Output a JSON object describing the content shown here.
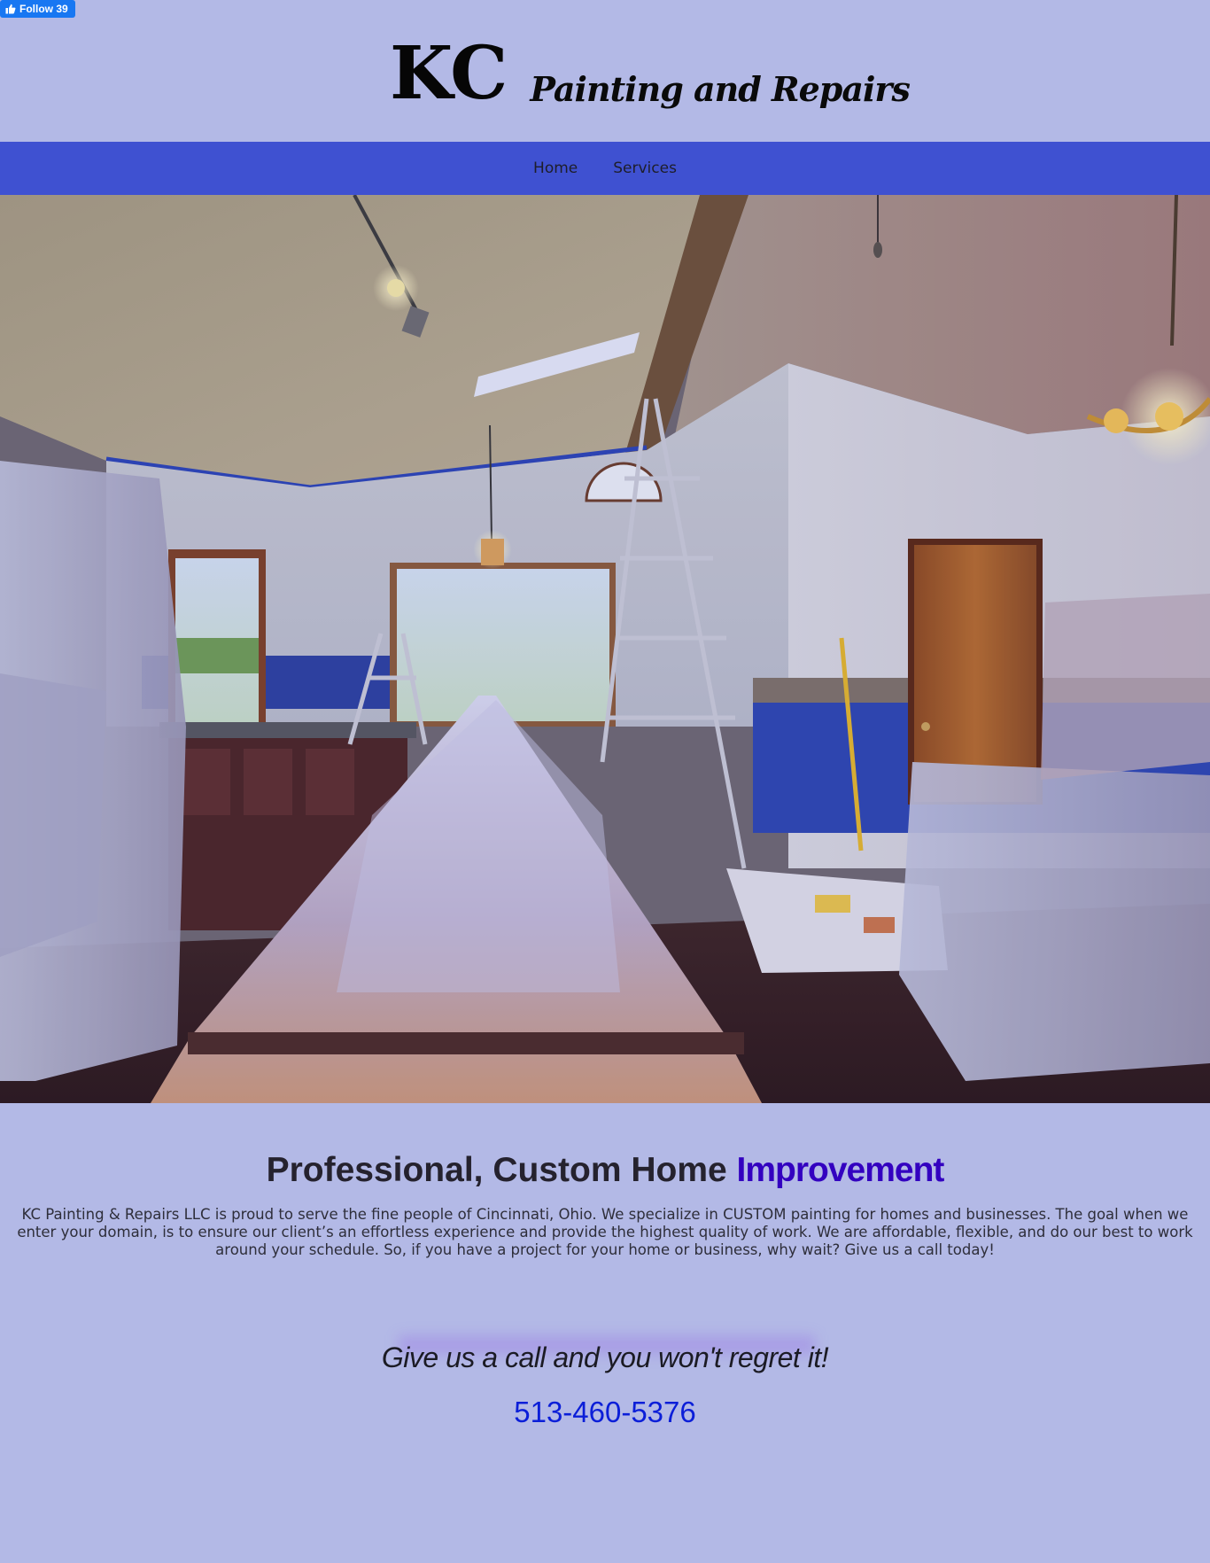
{
  "facebook": {
    "follow_label": "Follow 39"
  },
  "brand": {
    "logo_initials": "KC",
    "logo_tagline": "Painting and Repairs"
  },
  "nav": {
    "items": [
      {
        "label": "Home"
      },
      {
        "label": "Services"
      }
    ]
  },
  "hero": {
    "alt": "Interior room prepared for painting with furniture covered in plastic and ladders"
  },
  "intro": {
    "heading_main": "Professional, Custom Home ",
    "heading_accent": "Improvement",
    "body": "KC Painting & Repairs LLC is proud to serve the fine people of Cincinnati, Ohio. We specialize in CUSTOM painting for homes and businesses. The goal when we enter your domain, is to ensure our client’s an effortless experience and provide the highest quality of work. We are affordable, flexible, and do our best to work around your schedule. So, if you have a project for your home or business, why wait? Give us a call today!"
  },
  "cta": {
    "tagline": "Give us a call and you won't regret it!",
    "phone": "513-460-5376"
  },
  "colors": {
    "page_bg": "#b3b9e6",
    "nav_bg": "#3f51d1",
    "accent": "#3300c0",
    "phone": "#0b1ed8",
    "facebook": "#1877f2"
  }
}
